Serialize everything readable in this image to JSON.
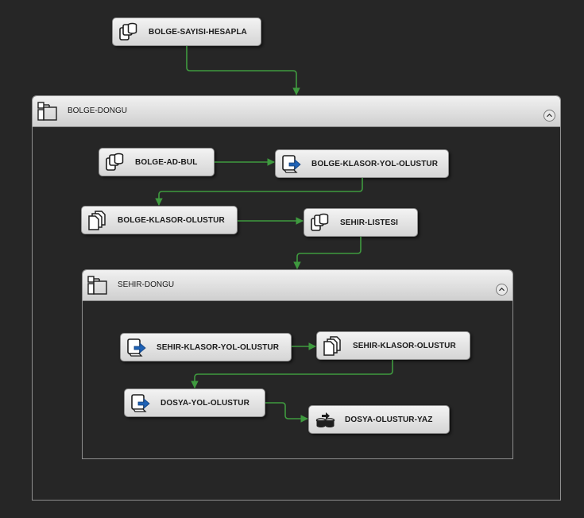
{
  "colors": {
    "connector": "#3f9a3f",
    "background": "#262626"
  },
  "tasks": {
    "bolge_sayisi_hesapla": {
      "label": "BOLGE-SAYISI-HESAPLA",
      "icon": "execute-sql-task-icon"
    },
    "bolge_ad_bul": {
      "label": "BOLGE-AD-BUL",
      "icon": "execute-sql-task-icon"
    },
    "bolge_klasor_yol_olustur": {
      "label": "BOLGE-KLASOR-YOL-OLUSTUR",
      "icon": "script-task-icon"
    },
    "bolge_klasor_olustur": {
      "label": "BOLGE-KLASOR-OLUSTUR",
      "icon": "file-system-task-icon"
    },
    "sehir_listesi": {
      "label": "SEHIR-LISTESI",
      "icon": "execute-sql-task-icon"
    },
    "sehir_klasor_yol_olustur": {
      "label": "SEHIR-KLASOR-YOL-OLUSTUR",
      "icon": "script-task-icon"
    },
    "sehir_klasor_olustur": {
      "label": "SEHIR-KLASOR-OLUSTUR",
      "icon": "file-system-task-icon"
    },
    "dosya_yol_olustur": {
      "label": "DOSYA-YOL-OLUSTUR",
      "icon": "script-task-icon"
    },
    "dosya_olustur_yaz": {
      "label": "DOSYA-OLUSTUR-YAZ",
      "icon": "data-flow-task-icon"
    }
  },
  "containers": {
    "bolge_dongu": {
      "label": "BOLGE-DONGU",
      "icon": "foreach-loop-container-icon"
    },
    "sehir_dongu": {
      "label": "SEHIR-DONGU",
      "icon": "foreach-loop-container-icon"
    }
  }
}
